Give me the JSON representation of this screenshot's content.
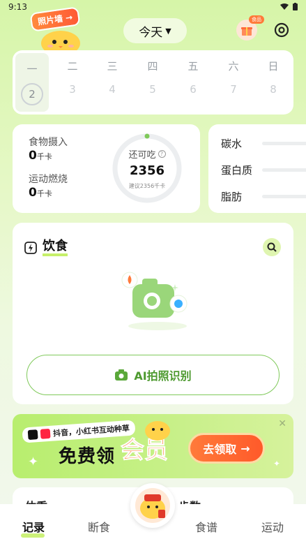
{
  "status_bar": {
    "time": "9:13"
  },
  "header": {
    "photo_wall_label": "照片墙 →",
    "date_selector": "今天",
    "gift_badge": "食品"
  },
  "week": {
    "days": [
      {
        "name": "一",
        "num": "2"
      },
      {
        "name": "二",
        "num": "3"
      },
      {
        "name": "三",
        "num": "4"
      },
      {
        "name": "四",
        "num": "5"
      },
      {
        "name": "五",
        "num": "6"
      },
      {
        "name": "六",
        "num": "7"
      },
      {
        "name": "日",
        "num": "8"
      }
    ]
  },
  "calories": {
    "intake_label": "食物摄入",
    "intake_value": "0",
    "burn_label": "运动燃烧",
    "burn_value": "0",
    "unit": "千卡",
    "remaining_label": "还可吃",
    "remaining_value": "2356",
    "suggest_text": "建议2356千卡",
    "progress": 0
  },
  "macros": {
    "carb": "碳水",
    "protein": "蛋白质",
    "fat": "脂肪"
  },
  "diet": {
    "title": "饮食",
    "ai_button": "AI拍照识别"
  },
  "banner": {
    "tag": "抖音，小红书互动种草",
    "main": "免费领",
    "vip": "会员",
    "cta": "去领取"
  },
  "next_section": {
    "left": "体重",
    "right": "步数"
  },
  "tabbar": {
    "tabs": [
      "记录",
      "断食",
      "食谱",
      "运动"
    ],
    "active": "记录"
  },
  "colors": {
    "accent_green": "#7fc95a",
    "cta_orange": "#ff6a32",
    "bg_green": "#d6f5a8"
  }
}
